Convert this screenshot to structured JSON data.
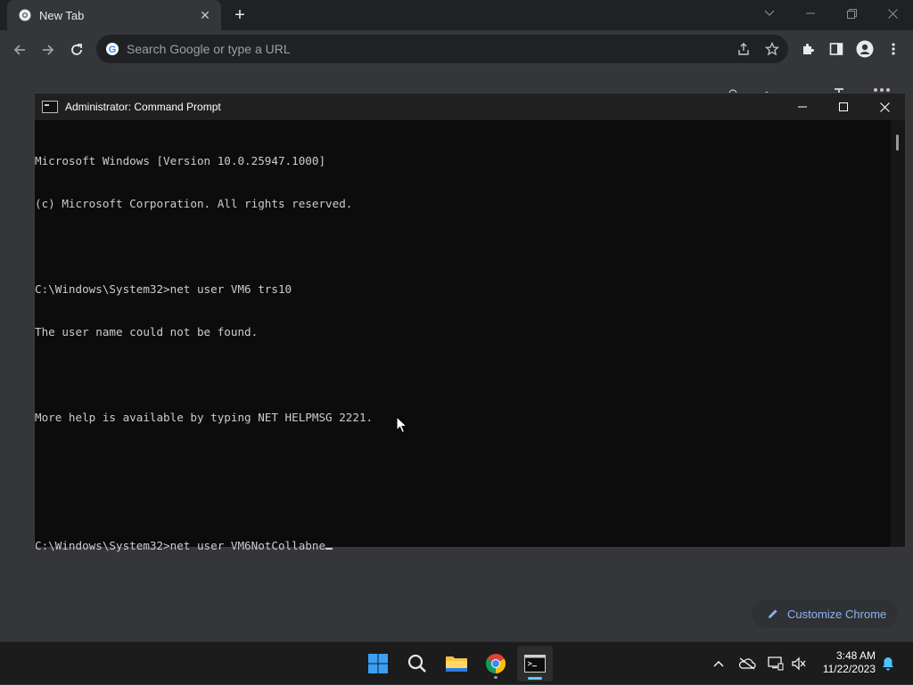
{
  "browser": {
    "tab_title": "New Tab",
    "omnibox_placeholder": "Search Google or type a URL",
    "customize_label": "Customize Chrome"
  },
  "cmd": {
    "title": "Administrator: Command Prompt",
    "lines": [
      "Microsoft Windows [Version 10.0.25947.1000]",
      "(c) Microsoft Corporation. All rights reserved.",
      "",
      "C:\\Windows\\System32>net user VM6 trs10",
      "The user name could not be found.",
      "",
      "More help is available by typing NET HELPMSG 2221.",
      "",
      "",
      "C:\\Windows\\System32>net user VM6NotCollabne"
    ]
  },
  "taskbar": {
    "time": "3:48 AM",
    "date": "11/22/2023",
    "apps": [
      "start-icon",
      "search-icon",
      "file-explorer-icon",
      "chrome-icon",
      "terminal-icon"
    ]
  },
  "colors": {
    "chrome_bg": "#35363a",
    "tabstrip_bg": "#202124",
    "console_bg": "#0c0c0c",
    "accent": "#8ab4f8",
    "taskbar_accent": "#60cdff"
  }
}
